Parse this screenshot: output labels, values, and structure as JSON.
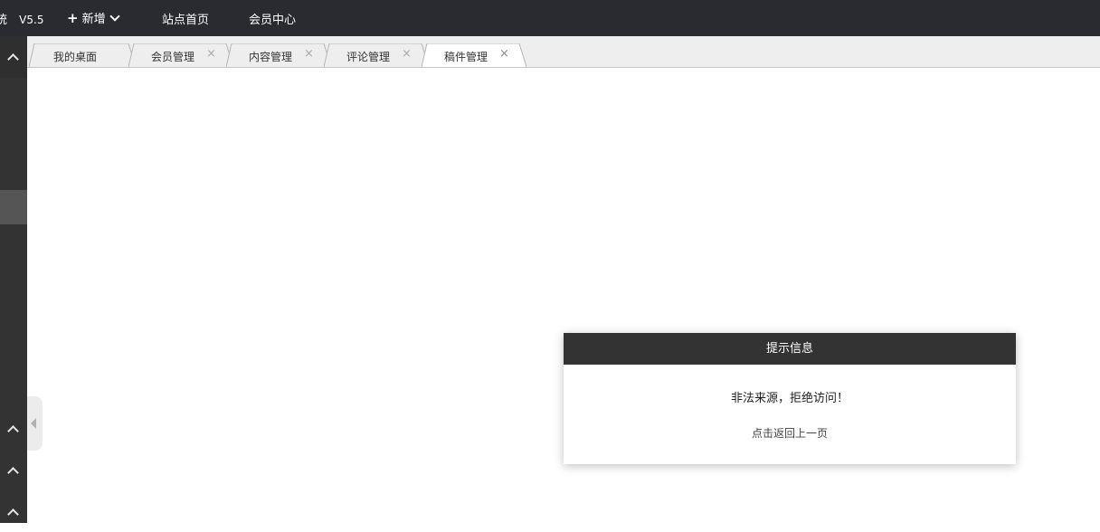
{
  "app": {
    "brand_name": "统",
    "version": "V5.5"
  },
  "topnav": {
    "new_label": "新增",
    "links": [
      "站点首页",
      "会员中心"
    ]
  },
  "tabs": [
    {
      "label": "我的桌面",
      "closable": false,
      "active": false
    },
    {
      "label": "会员管理",
      "closable": true,
      "active": false
    },
    {
      "label": "内容管理",
      "closable": true,
      "active": false
    },
    {
      "label": "评论管理",
      "closable": true,
      "active": false
    },
    {
      "label": "稿件管理",
      "closable": true,
      "active": true
    }
  ],
  "tab_close_glyph": "×",
  "dialog": {
    "title": "提示信息",
    "message": "非法来源，拒绝访问！",
    "back_link": "点击返回上一页"
  },
  "colors": {
    "topbar": "#2a2b30",
    "sidebar": "#333333",
    "sidebar_active": "#555555",
    "dialog_header": "#333333",
    "tabbar": "#eeeeee"
  },
  "icons": [
    "plus-icon",
    "chevron-down-icon",
    "chevron-up-icon",
    "collapse-left-icon",
    "close-icon"
  ]
}
